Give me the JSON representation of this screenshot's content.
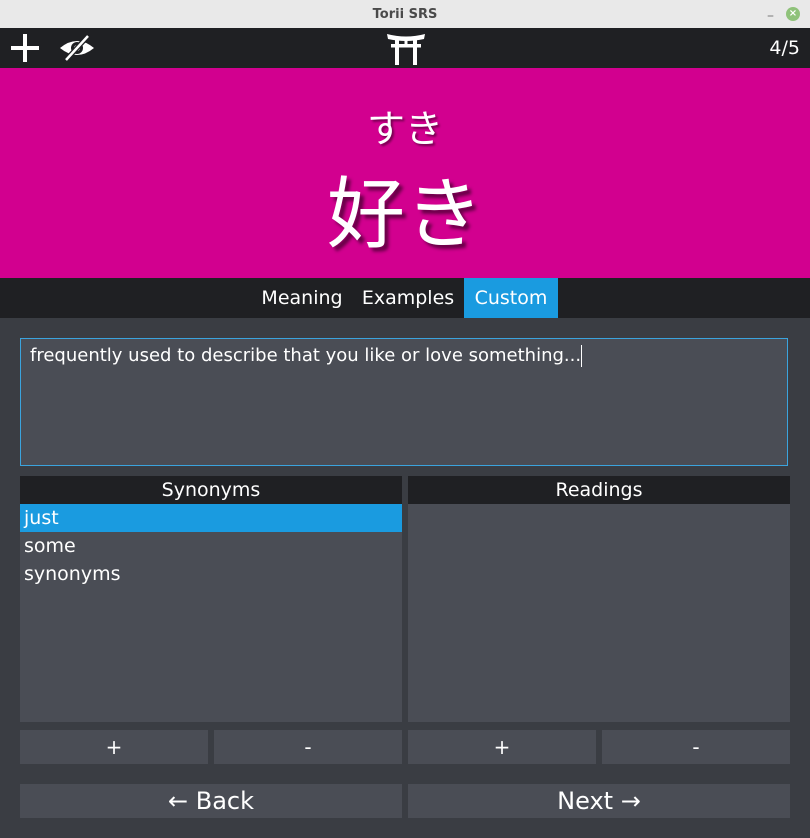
{
  "window": {
    "title": "Torii SRS",
    "minimize": "–",
    "close": "×"
  },
  "toolbar": {
    "add_icon": "plus-icon",
    "hide_icon": "eye-slash-icon",
    "logo_icon": "torii-gate-icon",
    "counter": "4/5"
  },
  "card": {
    "reading": "すき",
    "word": "好き"
  },
  "tabs": [
    {
      "label": "Meaning",
      "active": false
    },
    {
      "label": "Examples",
      "active": false
    },
    {
      "label": "Custom",
      "active": true
    }
  ],
  "custom": {
    "note": "frequently used to describe that you like or love something..."
  },
  "synonyms": {
    "header": "Synonyms",
    "items": [
      "just",
      "some",
      "synonyms"
    ],
    "selected": "just",
    "add_label": "+",
    "remove_label": "-"
  },
  "readings": {
    "header": "Readings",
    "items": [],
    "add_label": "+",
    "remove_label": "-"
  },
  "nav": {
    "back_label": "← Back",
    "next_label": "Next →"
  },
  "colors": {
    "banner": "#d2008f",
    "accent": "#1a9be0",
    "panel": "#4a4d55",
    "bar": "#1f2023"
  }
}
